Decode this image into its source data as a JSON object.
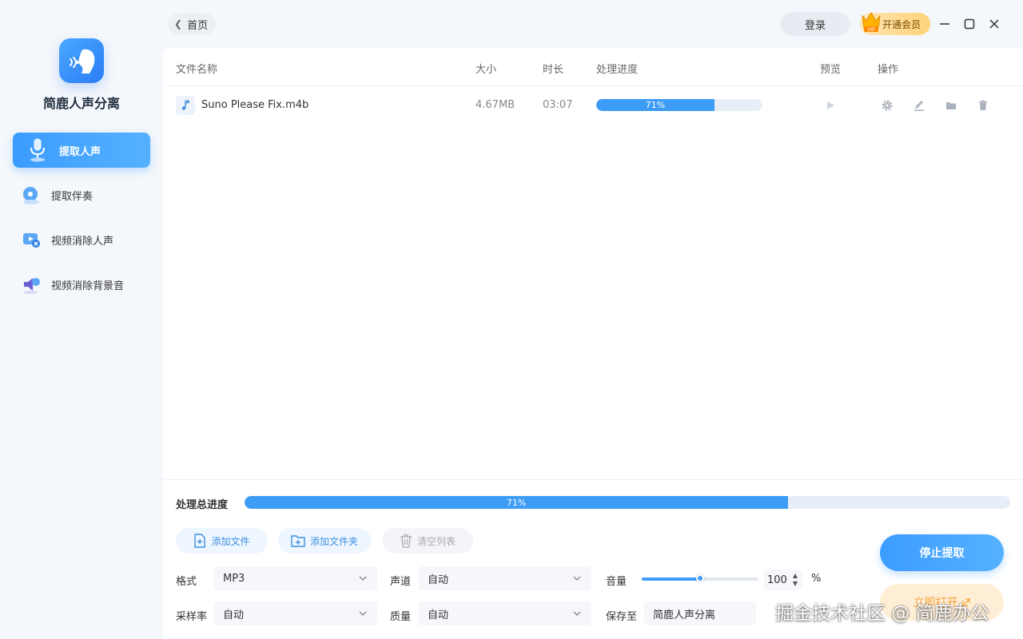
{
  "app": {
    "name": "简鹿人声分离"
  },
  "sidebar": {
    "items": [
      {
        "label": "提取人声",
        "icon": "microphone-icon",
        "active": true
      },
      {
        "label": "提取伴奏",
        "icon": "music-disc-icon",
        "active": false
      },
      {
        "label": "视频消除人声",
        "icon": "video-mute-icon",
        "active": false
      },
      {
        "label": "视频消除背景音",
        "icon": "speaker-icon",
        "active": false
      }
    ]
  },
  "topbar": {
    "back_label": "首页",
    "login_label": "登录",
    "vip_label": "开通会员",
    "vip_badge": "VIP"
  },
  "table": {
    "headers": {
      "name": "文件名称",
      "size": "大小",
      "duration": "时长",
      "progress": "处理进度",
      "preview": "预览",
      "actions": "操作"
    },
    "rows": [
      {
        "name": "Suno Please Fix.m4b",
        "size": "4.67MB",
        "duration": "03:07",
        "progress": 71,
        "progress_label": "71%"
      }
    ]
  },
  "bottom": {
    "total_label": "处理总进度",
    "total_progress": 71,
    "total_progress_label": "71%",
    "add_file": "添加文件",
    "add_folder": "添加文件夹",
    "clear_list": "清空列表",
    "format_label": "格式",
    "format_value": "MP3",
    "channel_label": "声道",
    "channel_value": "自动",
    "volume_label": "音量",
    "volume_value": "100",
    "volume_fraction": 0.5,
    "volume_unit": "%",
    "samplerate_label": "采样率",
    "samplerate_value": "自动",
    "quality_label": "质量",
    "quality_value": "自动",
    "saveto_label": "保存至",
    "saveto_value": "简鹿人声分离",
    "stop_label": "停止提取",
    "open_label": "立即打开"
  },
  "watermark": "掘金技术社区 @ 简鹿办公",
  "colors": {
    "accent": "#3d9cf5",
    "vip": "#ffd27a"
  }
}
